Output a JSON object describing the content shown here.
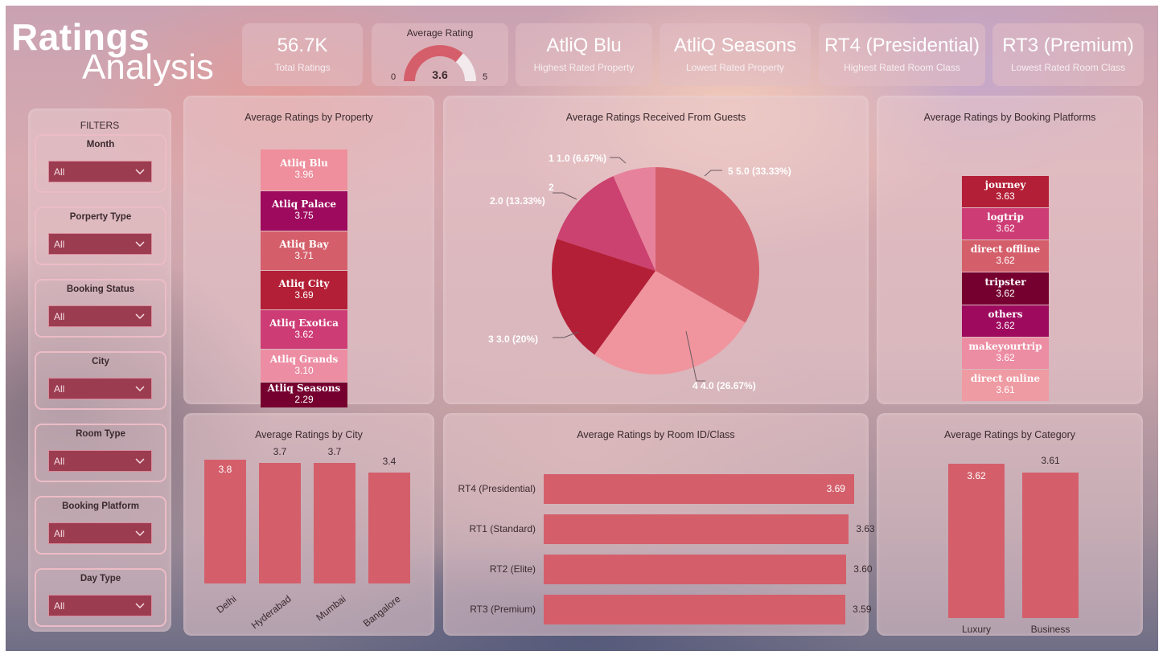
{
  "header": {
    "title_line1": "Ratings",
    "title_line2": "Analysis"
  },
  "kpis": {
    "total_ratings": {
      "value": "56.7K",
      "label": "Total Ratings"
    },
    "average_rating": {
      "title": "Average Rating",
      "value": "3.6",
      "value_number": 3.6,
      "min": "0",
      "max": "5",
      "min_number": 0,
      "max_number": 5
    },
    "highest_property": {
      "value": "AtliQ Blu",
      "label": "Highest Rated Property"
    },
    "lowest_property": {
      "value": "AtliQ Seasons",
      "label": "Lowest Rated Property"
    },
    "highest_room": {
      "value": "RT4 (Presidential)",
      "label": "Highest Rated Room Class"
    },
    "lowest_room": {
      "value": "RT3 (Premium)",
      "label": "Lowest Rated Room Class"
    }
  },
  "filters": {
    "heading": "FILTERS",
    "slicers": [
      {
        "label": "Month",
        "value": "All"
      },
      {
        "label": "Porperty Type",
        "value": "All"
      },
      {
        "label": "Booking Status",
        "value": "All"
      },
      {
        "label": "City",
        "value": "All"
      },
      {
        "label": "Room Type",
        "value": "All"
      },
      {
        "label": "Booking Platform",
        "value": "All"
      },
      {
        "label": "Day Type",
        "value": "All"
      }
    ]
  },
  "colors": {
    "bar": "#d45f6b",
    "property_segments": [
      "#ef8e9c",
      "#9e0a5e",
      "#d45f6b",
      "#b31f36",
      "#ce3c75",
      "#ec8da3",
      "#75002f"
    ],
    "platform_segments": [
      "#b31f36",
      "#ce3c75",
      "#d45f6b",
      "#75002f",
      "#9e0a5e",
      "#ec8da3",
      "#ef9ba3"
    ],
    "pie": [
      "#d45f6b",
      "#f0959e",
      "#b31f36",
      "#cb416f",
      "#e7829c"
    ]
  },
  "chart_data": [
    {
      "type": "bar",
      "title": "Average Ratings by Property",
      "categories": [
        "Atliq Blu",
        "Atliq Palace",
        "Atliq Bay",
        "Atliq City",
        "Atliq Exotica",
        "Atliq Grands",
        "Atliq Seasons"
      ],
      "labels": [
        "3.96",
        "3.75",
        "3.71",
        "3.69",
        "3.62",
        "3.10",
        "2.29"
      ],
      "values": [
        3.96,
        3.75,
        3.71,
        3.69,
        3.62,
        3.1,
        2.29
      ]
    },
    {
      "type": "pie",
      "title": "Average Ratings Received From Guests",
      "categories": [
        "5",
        "4",
        "3",
        "2",
        "1"
      ],
      "values": [
        5.0,
        4.0,
        3.0,
        2.0,
        1.0
      ],
      "labels": [
        "5 5.0 (33.33%)",
        "4 4.0 (26.67%)",
        "3 3.0 (20%)",
        "2",
        "2.0 (13.33%)",
        "1 1.0 (6.67%)"
      ]
    },
    {
      "type": "bar",
      "title": "Average Ratings by Booking Platforms",
      "categories": [
        "journey",
        "logtrip",
        "direct offline",
        "tripster",
        "others",
        "makeyourtrip",
        "direct online"
      ],
      "labels": [
        "3.63",
        "3.62",
        "3.62",
        "3.62",
        "3.62",
        "3.62",
        "3.61"
      ],
      "values": [
        3.63,
        3.62,
        3.62,
        3.62,
        3.62,
        3.62,
        3.61
      ]
    },
    {
      "type": "bar",
      "title": "Average Ratings by City",
      "categories": [
        "Delhi",
        "Hyderabad",
        "Mumbai",
        "Bangalore"
      ],
      "labels": [
        "3.8",
        "3.7",
        "3.7",
        "3.4"
      ],
      "values": [
        3.8,
        3.7,
        3.7,
        3.4
      ]
    },
    {
      "type": "bar",
      "title": "Average Ratings by Room ID/Class",
      "categories": [
        "RT4 (Presidential)",
        "RT1 (Standard)",
        "RT2 (Elite)",
        "RT3 (Premium)"
      ],
      "labels": [
        "3.69",
        "3.63",
        "3.60",
        "3.59"
      ],
      "values": [
        3.69,
        3.63,
        3.6,
        3.59
      ]
    },
    {
      "type": "bar",
      "title": "Average Ratings by Category",
      "categories": [
        "Luxury",
        "Business"
      ],
      "labels": [
        "3.62",
        "3.61"
      ],
      "values": [
        3.62,
        3.61
      ]
    }
  ]
}
